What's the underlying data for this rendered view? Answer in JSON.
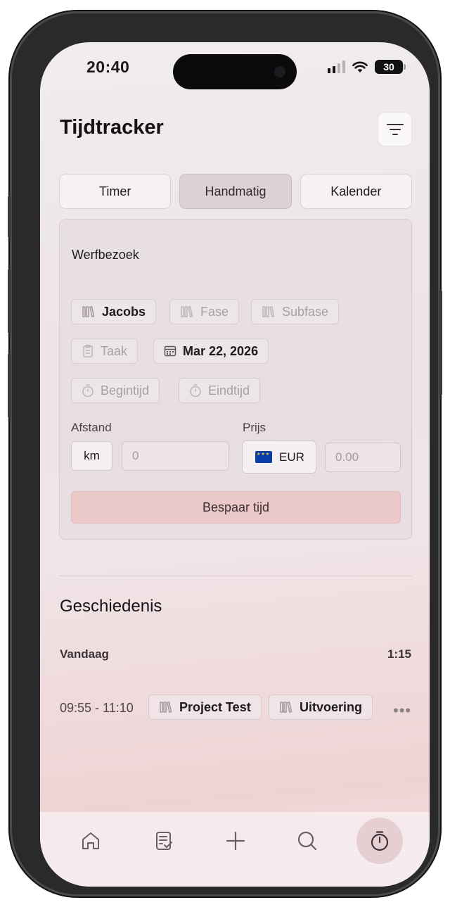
{
  "status_bar": {
    "time": "20:40",
    "battery": "30",
    "battery_level": 0.3
  },
  "header": {
    "title": "Tijdtracker"
  },
  "tabs": [
    {
      "label": "Timer",
      "active": false
    },
    {
      "label": "Handmatig",
      "active": true
    },
    {
      "label": "Kalender",
      "active": false
    }
  ],
  "form": {
    "description": "Werfbezoek",
    "project": "Jacobs",
    "phase_placeholder": "Fase",
    "subphase_placeholder": "Subfase",
    "task_placeholder": "Taak",
    "date": "Mar 22, 2026",
    "start_placeholder": "Begintijd",
    "end_placeholder": "Eindtijd",
    "distance_label": "Afstand",
    "distance_unit": "km",
    "distance_value": "0",
    "price_label": "Prijs",
    "currency": "EUR",
    "price_value": "0.00",
    "save_label": "Bespaar tijd"
  },
  "history": {
    "title": "Geschiedenis",
    "group_label": "Vandaag",
    "group_total": "1:15",
    "entries": [
      {
        "time": "09:55 - 11:10",
        "project": "Project Test",
        "phase": "Uitvoering",
        "more": "•••"
      }
    ]
  },
  "bottom_nav": [
    {
      "icon": "home-icon",
      "active": false
    },
    {
      "icon": "checklist-icon",
      "active": false
    },
    {
      "icon": "plus-icon",
      "active": false
    },
    {
      "icon": "search-icon",
      "active": false
    },
    {
      "icon": "stopwatch-icon",
      "active": true
    }
  ]
}
